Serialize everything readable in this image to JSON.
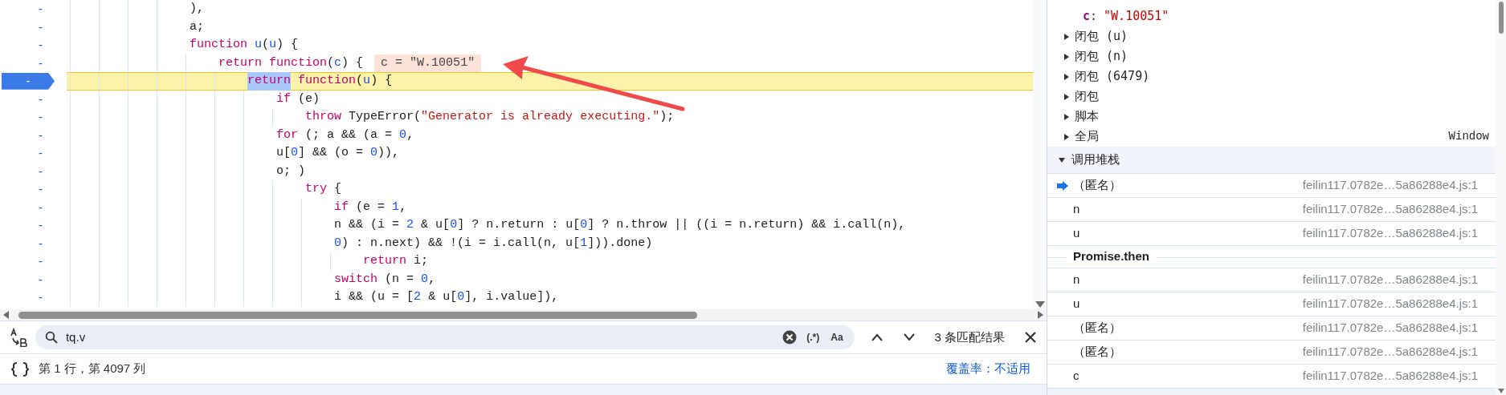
{
  "editor": {
    "lines": [
      {
        "marker": "-",
        "paused": false,
        "tokens": [
          {
            "text": "                ),",
            "kind": "plain",
            "highlighted": false
          }
        ]
      },
      {
        "marker": "-",
        "paused": false,
        "tokens": [
          {
            "text": "                a;",
            "kind": "plain",
            "highlighted": false
          }
        ]
      },
      {
        "marker": "-",
        "paused": false,
        "tokens": [
          {
            "text": "                function ",
            "kind": "kw",
            "highlighted": false
          },
          {
            "text": "u",
            "kind": "param",
            "highlighted": false
          },
          {
            "text": "(",
            "kind": "plain",
            "highlighted": false
          },
          {
            "text": "u",
            "kind": "param",
            "highlighted": false
          },
          {
            "text": ") {",
            "kind": "plain",
            "highlighted": false
          }
        ]
      },
      {
        "marker": "-",
        "paused": false,
        "inline_value": "c = \"W.10051\"",
        "tokens": [
          {
            "text": "                    return function",
            "kind": "kw",
            "highlighted": false
          },
          {
            "text": "(",
            "kind": "plain",
            "highlighted": false
          },
          {
            "text": "c",
            "kind": "param",
            "highlighted": false
          },
          {
            "text": ") {",
            "kind": "plain",
            "highlighted": false
          }
        ]
      },
      {
        "marker": "-",
        "paused": true,
        "tokens": [
          {
            "text": "                        return",
            "kind": "kw",
            "highlighted": true
          },
          {
            "text": " function",
            "kind": "kw",
            "highlighted": false
          },
          {
            "text": "(",
            "kind": "plain",
            "highlighted": false
          },
          {
            "text": "u",
            "kind": "param",
            "highlighted": false
          },
          {
            "text": ") {",
            "kind": "plain",
            "highlighted": false
          }
        ]
      },
      {
        "marker": "-",
        "paused": false,
        "tokens": [
          {
            "text": "                            if",
            "kind": "kw",
            "highlighted": false
          },
          {
            "text": " (e)",
            "kind": "plain",
            "highlighted": false
          }
        ]
      },
      {
        "marker": "-",
        "paused": false,
        "tokens": [
          {
            "text": "                                throw",
            "kind": "kw",
            "highlighted": false
          },
          {
            "text": " TypeError(",
            "kind": "plain",
            "highlighted": false
          },
          {
            "text": "\"Generator is already executing.\"",
            "kind": "str",
            "highlighted": false
          },
          {
            "text": ");",
            "kind": "plain",
            "highlighted": false
          }
        ]
      },
      {
        "marker": "-",
        "paused": false,
        "tokens": [
          {
            "text": "                            for",
            "kind": "kw",
            "highlighted": false
          },
          {
            "text": " (; a && (a = ",
            "kind": "plain",
            "highlighted": false
          },
          {
            "text": "0",
            "kind": "num",
            "highlighted": false
          },
          {
            "text": ",",
            "kind": "plain",
            "highlighted": false
          }
        ]
      },
      {
        "marker": "-",
        "paused": false,
        "tokens": [
          {
            "text": "                            u[",
            "kind": "plain",
            "highlighted": false
          },
          {
            "text": "0",
            "kind": "num",
            "highlighted": false
          },
          {
            "text": "] && (o = ",
            "kind": "plain",
            "highlighted": false
          },
          {
            "text": "0",
            "kind": "num",
            "highlighted": false
          },
          {
            "text": ")),",
            "kind": "plain",
            "highlighted": false
          }
        ]
      },
      {
        "marker": "-",
        "paused": false,
        "tokens": [
          {
            "text": "                            o; )",
            "kind": "plain",
            "highlighted": false
          }
        ]
      },
      {
        "marker": "-",
        "paused": false,
        "tokens": [
          {
            "text": "                                try",
            "kind": "kw",
            "highlighted": false
          },
          {
            "text": " {",
            "kind": "plain",
            "highlighted": false
          }
        ]
      },
      {
        "marker": "-",
        "paused": false,
        "tokens": [
          {
            "text": "                                    if",
            "kind": "kw",
            "highlighted": false
          },
          {
            "text": " (e = ",
            "kind": "plain",
            "highlighted": false
          },
          {
            "text": "1",
            "kind": "num",
            "highlighted": false
          },
          {
            "text": ",",
            "kind": "plain",
            "highlighted": false
          }
        ]
      },
      {
        "marker": "-",
        "paused": false,
        "tokens": [
          {
            "text": "                                    n && (i = ",
            "kind": "plain",
            "highlighted": false
          },
          {
            "text": "2",
            "kind": "num",
            "highlighted": false
          },
          {
            "text": " & u[",
            "kind": "plain",
            "highlighted": false
          },
          {
            "text": "0",
            "kind": "num",
            "highlighted": false
          },
          {
            "text": "] ? n.return : u[",
            "kind": "plain",
            "highlighted": false
          },
          {
            "text": "0",
            "kind": "num",
            "highlighted": false
          },
          {
            "text": "] ? n.throw || ((i = n.return) && i.call(n),",
            "kind": "plain",
            "highlighted": false
          }
        ]
      },
      {
        "marker": "-",
        "paused": false,
        "tokens": [
          {
            "text": "                                    0",
            "kind": "num",
            "highlighted": false
          },
          {
            "text": ") : n.next) && !(i = i.call(n, u[",
            "kind": "plain",
            "highlighted": false
          },
          {
            "text": "1",
            "kind": "num",
            "highlighted": false
          },
          {
            "text": "])).done)",
            "kind": "plain",
            "highlighted": false
          }
        ]
      },
      {
        "marker": "-",
        "paused": false,
        "tokens": [
          {
            "text": "                                        return",
            "kind": "kw",
            "highlighted": false
          },
          {
            "text": " i;",
            "kind": "plain",
            "highlighted": false
          }
        ]
      },
      {
        "marker": "-",
        "paused": false,
        "tokens": [
          {
            "text": "                                    switch",
            "kind": "kw",
            "highlighted": false
          },
          {
            "text": " (n = ",
            "kind": "plain",
            "highlighted": false
          },
          {
            "text": "0",
            "kind": "num",
            "highlighted": false
          },
          {
            "text": ",",
            "kind": "plain",
            "highlighted": false
          }
        ]
      },
      {
        "marker": "-",
        "paused": false,
        "tokens": [
          {
            "text": "                                    i && (u = [",
            "kind": "plain",
            "highlighted": false
          },
          {
            "text": "2",
            "kind": "num",
            "highlighted": false
          },
          {
            "text": " & u[",
            "kind": "plain",
            "highlighted": false
          },
          {
            "text": "0",
            "kind": "num",
            "highlighted": false
          },
          {
            "text": "], i.value]),",
            "kind": "plain",
            "highlighted": false
          }
        ]
      }
    ]
  },
  "search": {
    "value": "tq.v",
    "regex_toggle": "(.*)",
    "case_toggle": "Aa",
    "result_count": "3 条匹配结果"
  },
  "status_bar": {
    "position": "第 1 行，第 4097 列",
    "coverage": "覆盖率：不适用"
  },
  "scope": {
    "variable": {
      "name": "c",
      "separator": ":",
      "value": "\"W.10051\""
    },
    "items": [
      {
        "label": "闭包 (u)",
        "expanded": false
      },
      {
        "label": "闭包 (n)",
        "expanded": false
      },
      {
        "label": "闭包 (6479)",
        "expanded": false
      },
      {
        "label": "闭包",
        "expanded": false
      },
      {
        "label": "脚本",
        "expanded": false
      },
      {
        "label": "全局",
        "expanded": false,
        "value": "Window"
      }
    ]
  },
  "call_stack": {
    "title": "调用堆栈",
    "expanded": true,
    "entries": [
      {
        "kind": "frame",
        "name": "（匿名）",
        "location": "feilin117.0782e…5a86288e4.js:1",
        "current": true
      },
      {
        "kind": "frame",
        "name": "n",
        "location": "feilin117.0782e…5a86288e4.js:1",
        "current": false
      },
      {
        "kind": "frame",
        "name": "u",
        "location": "feilin117.0782e…5a86288e4.js:1",
        "current": false
      },
      {
        "kind": "async",
        "name": "Promise.then"
      },
      {
        "kind": "frame",
        "name": "n",
        "location": "feilin117.0782e…5a86288e4.js:1",
        "current": false
      },
      {
        "kind": "frame",
        "name": "u",
        "location": "feilin117.0782e…5a86288e4.js:1",
        "current": false
      },
      {
        "kind": "frame",
        "name": "（匿名）",
        "location": "feilin117.0782e…5a86288e4.js:1",
        "current": false
      },
      {
        "kind": "frame",
        "name": "（匿名）",
        "location": "feilin117.0782e…5a86288e4.js:1",
        "current": false
      },
      {
        "kind": "frame",
        "name": "c",
        "location": "feilin117.0782e…5a86288e4.js:1",
        "current": false
      }
    ]
  }
}
